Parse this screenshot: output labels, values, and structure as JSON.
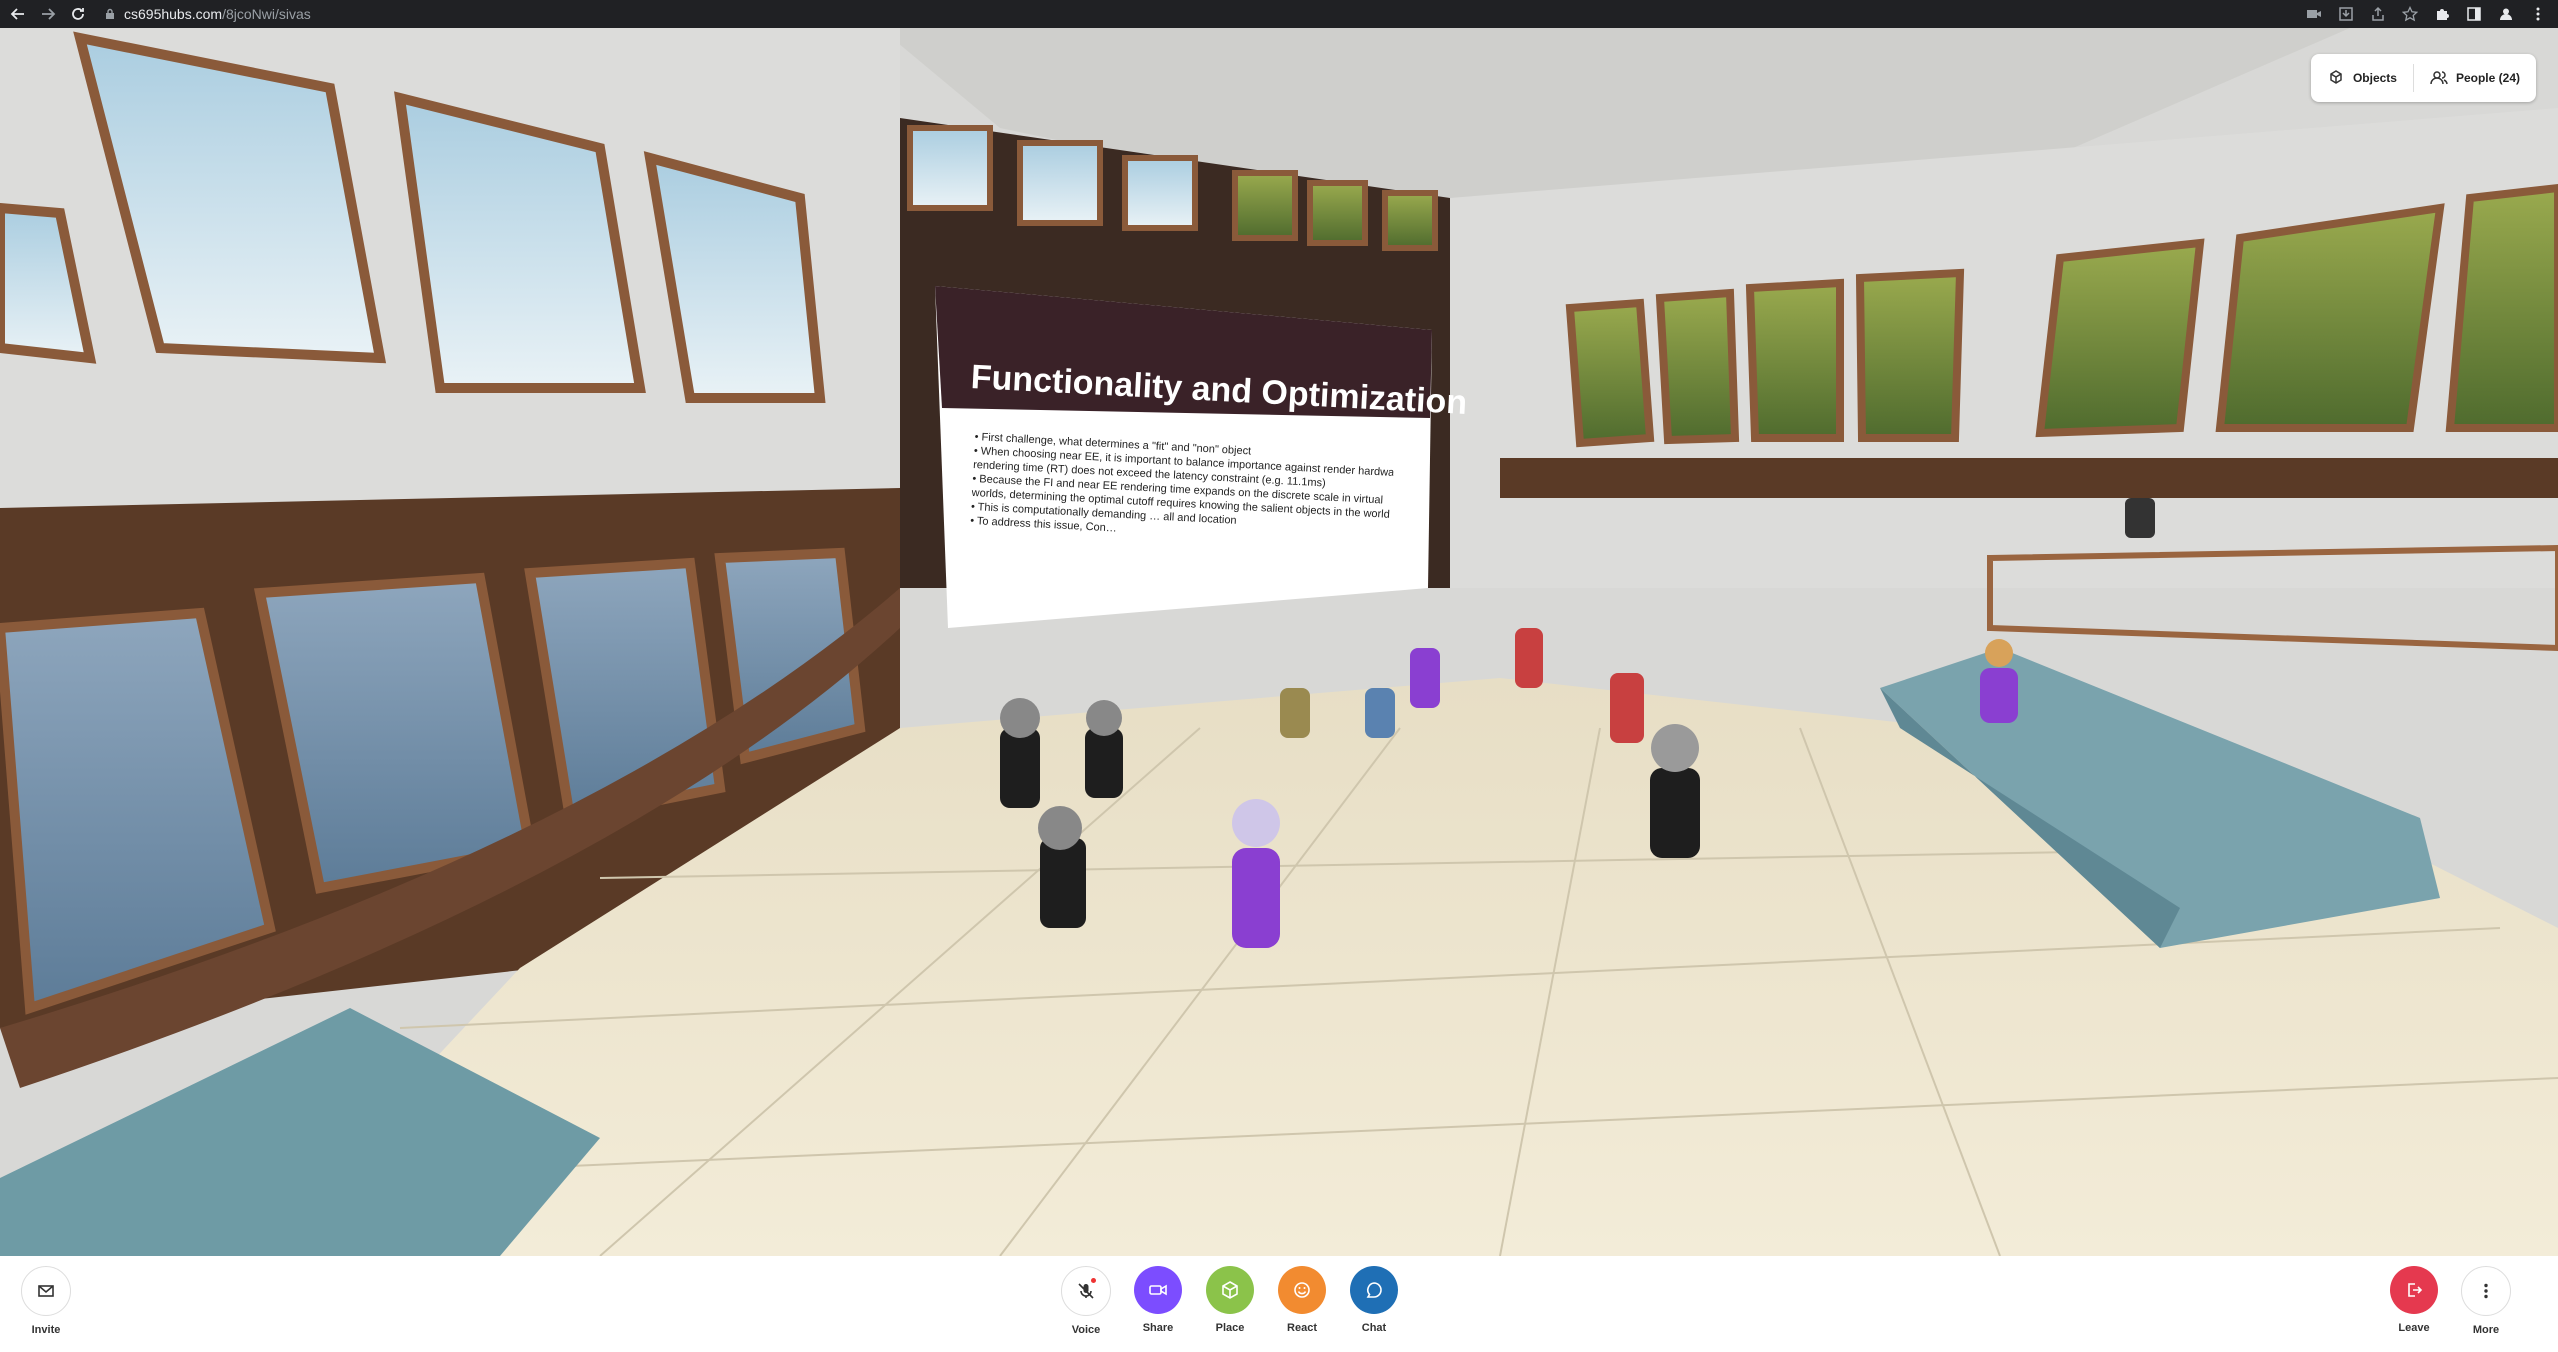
{
  "browser": {
    "url_host": "cs695hubs.com",
    "url_path": "/8jcoNwi/sivas"
  },
  "slide": {
    "title": "Functionality and Optimization",
    "lines": [
      "• First challenge, what determines a \"fit\" and \"non\" object",
      "• When choosing near EE, it is important to balance importance against render hardware",
      "  rendering time (RT) does not exceed the latency constraint (e.g. 11.1ms)",
      "• Because the FI and near EE rendering time expands on the discrete scale in virtual",
      "  worlds, determining the optimal cutoff requires knowing the salient objects in the world",
      "• This is computationally demanding … all and location",
      "• To address this issue, Con…"
    ]
  },
  "panel": {
    "objects_label": "Objects",
    "people_label": "People (24)"
  },
  "toolbar": {
    "invite": "Invite",
    "voice": "Voice",
    "share": "Share",
    "place": "Place",
    "react": "React",
    "chat": "Chat",
    "leave": "Leave",
    "more": "More"
  },
  "colors": {
    "share": "#7c4dff",
    "place": "#8bc34a",
    "react": "#f28b30",
    "chat": "#1f6fb5",
    "leave": "#e5394f",
    "slide_header": "#3a2228"
  },
  "icons": [
    "back-icon",
    "forward-icon",
    "reload-icon",
    "lock-icon",
    "objects-icon",
    "people-icon",
    "mail-icon",
    "mic-muted-icon",
    "video-icon",
    "cube-icon",
    "smile-icon",
    "chat-bubble-icon",
    "exit-icon",
    "more-vertical-icon"
  ]
}
